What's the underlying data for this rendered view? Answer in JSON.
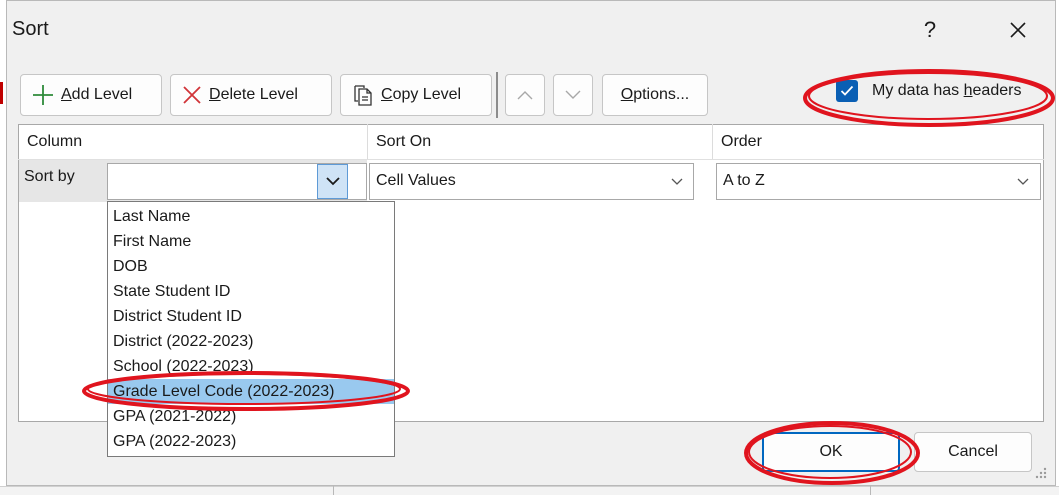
{
  "dialog": {
    "title": "Sort",
    "help_label": "?",
    "close_label": "✕"
  },
  "toolbar": {
    "add_level": {
      "accel": "A",
      "rest": "dd Level"
    },
    "delete_level": {
      "accel": "D",
      "rest": "elete Level"
    },
    "copy_level": {
      "accel": "C",
      "rest": "opy Level"
    },
    "options": {
      "accel": "O",
      "rest": "ptions..."
    },
    "headers_checkbox": {
      "prefix": "My data has ",
      "accel": "h",
      "rest": "eaders",
      "checked": true
    }
  },
  "grid": {
    "headers": {
      "column": "Column",
      "sort_on": "Sort On",
      "order": "Order"
    },
    "row": {
      "label": "Sort by",
      "column_value": "",
      "sort_on_value": "Cell Values",
      "order_value": "A to Z"
    }
  },
  "dropdown": {
    "items": [
      "Last Name",
      "First Name",
      "DOB",
      "State Student ID",
      "District Student ID",
      "District  (2022-2023)",
      "School  (2022-2023)",
      "Grade Level Code  (2022-2023)",
      "GPA  (2021-2022)",
      "GPA  (2022-2023)"
    ],
    "selected": "Grade Level Code  (2022-2023)"
  },
  "buttons": {
    "ok": "OK",
    "cancel": "Cancel"
  },
  "colors": {
    "accent": "#0067c0",
    "checkbox": "#0a5fb4",
    "selection": "#99c9ef",
    "annotation": "#e0141e",
    "add_plus": "#2e8b3a",
    "delete_x": "#d13438"
  },
  "icons": [
    "plus-icon",
    "delete-x-icon",
    "copy-icon",
    "move-up-icon",
    "move-down-icon",
    "chevron-down-icon",
    "check-icon",
    "close-icon",
    "help-icon",
    "resize-grip-icon"
  ]
}
